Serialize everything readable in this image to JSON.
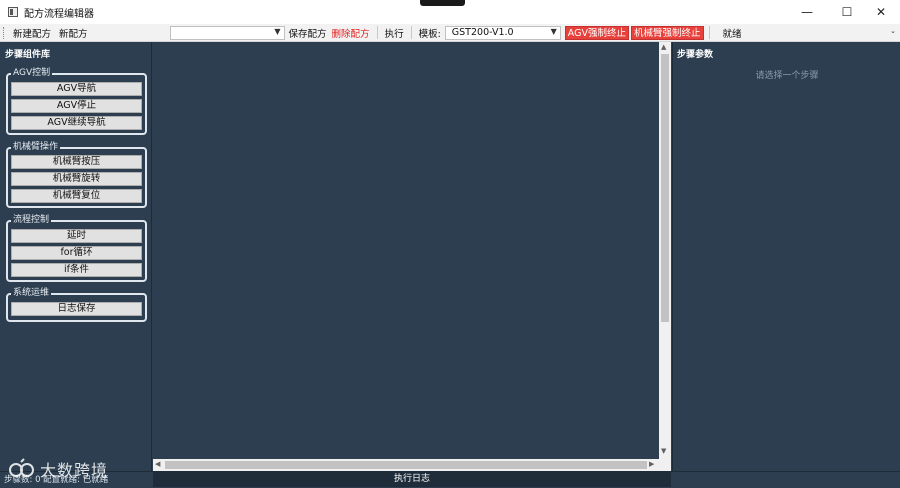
{
  "window": {
    "title": "配方流程编辑器",
    "minimize_glyph": "—",
    "maximize_glyph": "☐",
    "close_glyph": "✕"
  },
  "toolbar": {
    "new_recipe": "新建配方",
    "new_recipe2": "新配方",
    "recipe_combo_value": "",
    "save_recipe": "保存配方",
    "delete_recipe": "删除配方",
    "execute": "执行",
    "template_label": "模板:",
    "template_value": "GST200-V1.0",
    "agv_force_stop": "AGV强制终止",
    "arm_force_stop": "机械臂强制终止",
    "status": "就绪",
    "overflow_glyph": "⌄"
  },
  "left_panel": {
    "title": "步骤组件库",
    "groups": [
      {
        "label": "AGV控制",
        "items": [
          "AGV导航",
          "AGV停止",
          "AGV继续导航"
        ]
      },
      {
        "label": "机械臂操作",
        "items": [
          "机械臂按压",
          "机械臂旋转",
          "机械臂复位"
        ]
      },
      {
        "label": "流程控制",
        "items": [
          "延时",
          "for循环",
          "if条件"
        ]
      },
      {
        "label": "系统运维",
        "items": [
          "日志保存"
        ]
      }
    ]
  },
  "right_panel": {
    "title": "步骤参数",
    "hint": "请选择一个步骤"
  },
  "bottom": {
    "log_label": "执行日志",
    "status_text": "步骤数: 0    配置就绪: 已就绪",
    "watermark_text": "大数跨境"
  },
  "colors": {
    "background": "#2c3e50",
    "stop_button": "#e8413c",
    "delete_text": "#e0201e"
  }
}
